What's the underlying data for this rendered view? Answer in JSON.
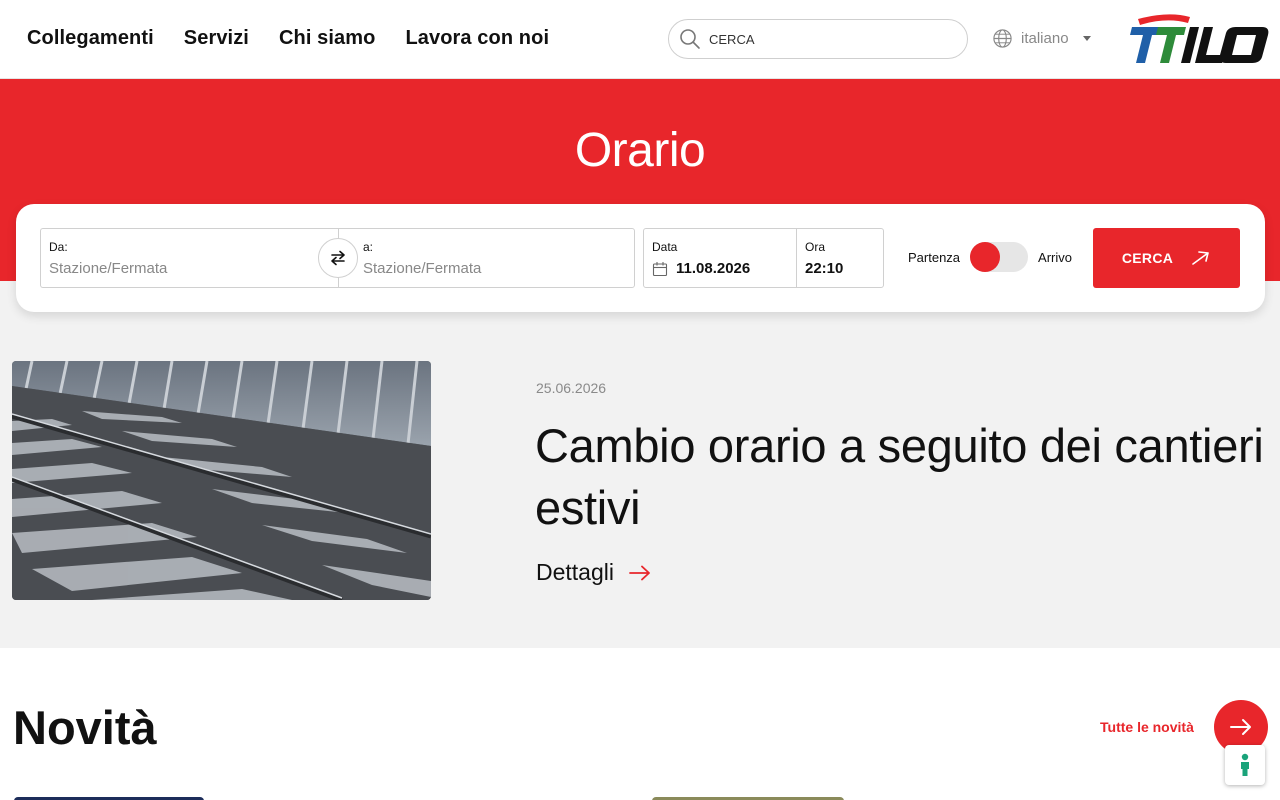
{
  "header": {
    "nav": [
      "Collegamenti",
      "Servizi",
      "Chi siamo",
      "Lavora con noi"
    ],
    "search_placeholder": "CERCA",
    "language": "italiano",
    "logo_text": "TILO"
  },
  "hero": {
    "title": "Orario"
  },
  "timetable": {
    "from_label": "Da:",
    "from_placeholder": "Stazione/Fermata",
    "to_label": "a:",
    "to_placeholder": "Stazione/Fermata",
    "date_label": "Data",
    "date_value": "11.08.2026",
    "time_label": "Ora",
    "time_value": "22:10",
    "toggle_left": "Partenza",
    "toggle_right": "Arrivo",
    "search_button": "CERCA"
  },
  "feature": {
    "date": "25.06.2026",
    "title": "Cambio orario a seguito dei cantieri estivi",
    "link": "Dettagli"
  },
  "news": {
    "heading": "Novità",
    "all_link": "Tutte le novità"
  },
  "colors": {
    "brand_red": "#e8262b",
    "logo_blue": "#1f5fa8",
    "logo_green": "#2e8b3a"
  }
}
